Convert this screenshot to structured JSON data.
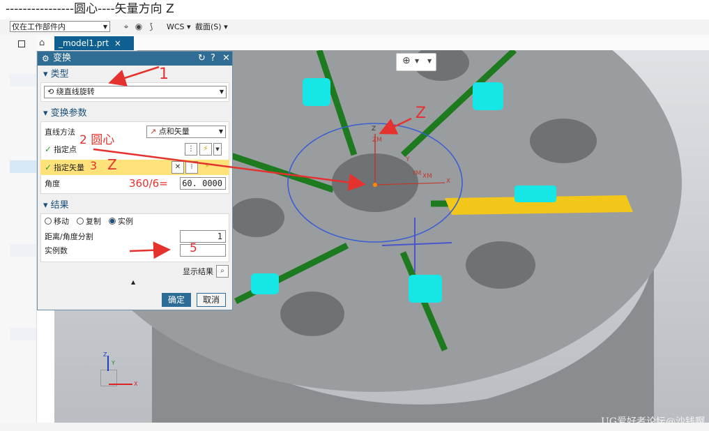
{
  "tutorial": {
    "title": "----------------圆心----矢量方向 Z"
  },
  "toolbar": {
    "filter_select": "仅在工作部件内",
    "wcs_label": "WCS",
    "section_label": "截面(S)"
  },
  "tabs": {
    "model_tab": "_model1.prt"
  },
  "dialog": {
    "title": "变换",
    "header_icons": [
      "reset-icon",
      "help-icon",
      "close-icon"
    ],
    "type_section": {
      "heading": "类型",
      "selected": "绕直线旋转"
    },
    "params_section": {
      "heading": "变换参数",
      "line_method_label": "直线方法",
      "line_method_value": "点和矢量",
      "specify_point_label": "指定点",
      "specify_vector_label": "指定矢量",
      "angle_label": "角度",
      "angle_value": "60. 0000"
    },
    "result_section": {
      "heading": "结果",
      "options": [
        "移动",
        "复制",
        "实例"
      ],
      "selected_option": "实例",
      "distance_label": "距离/角度分割",
      "distance_value": "1",
      "instances_label": "实例数",
      "instances_value": "5"
    },
    "show_result_label": "显示结果",
    "ok_label": "确定",
    "cancel_label": "取消"
  },
  "annotations": {
    "n1": "1",
    "n2": "2 圆心",
    "n3": "3",
    "z_vector": "Z",
    "z_top": "Z",
    "formula": "360/6="
  },
  "axis_labels": {
    "zm": "ZM",
    "xm": "XM",
    "ym": "YM",
    "x": "X",
    "y": "Y",
    "z": "Z"
  },
  "triad_labels": {
    "z": "Z",
    "y": "Y",
    "x": "X"
  },
  "watermark": "UG爱好者论坛@沙钱啊",
  "colors": {
    "accent": "#2f6d95",
    "highlight": "#ffe27a",
    "annotation": "#e5322e"
  }
}
